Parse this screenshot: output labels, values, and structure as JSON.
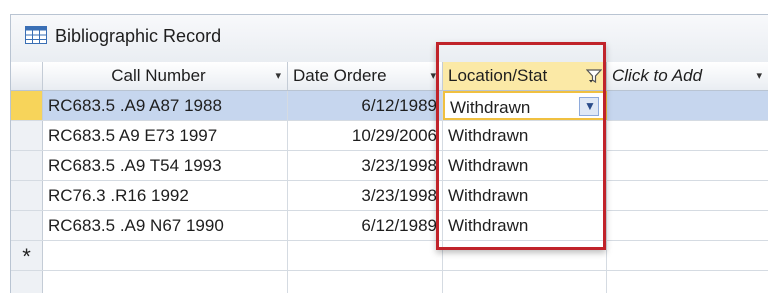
{
  "title": "Bibliographic Record",
  "columns": {
    "call_number": "Call Number",
    "date_ordered": "Date Ordere",
    "location_status": "Location/Stat",
    "click_to_add": "Click to Add"
  },
  "rows": [
    {
      "call_number": "RC683.5 .A9 A87 1988",
      "date_ordered": "6/12/1989",
      "location_status": "Withdrawn"
    },
    {
      "call_number": "RC683.5 A9 E73 1997",
      "date_ordered": "10/29/2006",
      "location_status": "Withdrawn"
    },
    {
      "call_number": "RC683.5 .A9 T54 1993",
      "date_ordered": "3/23/1998",
      "location_status": "Withdrawn"
    },
    {
      "call_number": "RC76.3 .R16 1992",
      "date_ordered": "3/23/1998",
      "location_status": "Withdrawn"
    },
    {
      "call_number": "RC683.5 .A9 N67 1990",
      "date_ordered": "6/12/1989",
      "location_status": "Withdrawn"
    }
  ],
  "new_row_marker": "*",
  "colors": {
    "highlight_border": "#c0232a",
    "selected_row": "#c6d6ee",
    "record_selector": "#f7d45a",
    "active_header": "#fbe9a6"
  }
}
